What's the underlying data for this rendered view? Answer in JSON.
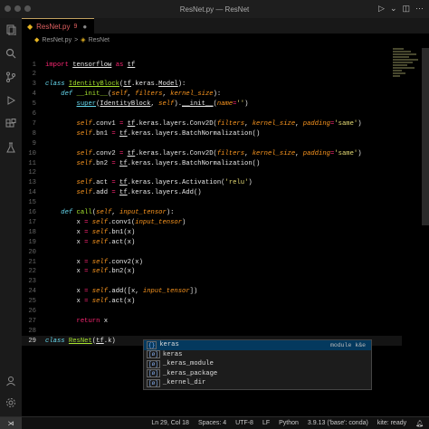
{
  "window": {
    "title": "ResNet.py — ResNet"
  },
  "tab": {
    "filename": "ResNet.py",
    "badge": "9"
  },
  "breadcrumb": {
    "file": "ResNet.py",
    "separator": ">",
    "symbol": "ResNet"
  },
  "code_lines": [
    {
      "num": "1",
      "html": "<span class='kw'>import</span> <span class='ul'>tensorflow</span> <span class='kw'>as</span> <span class='ul'>tf</span>"
    },
    {
      "num": "2",
      "html": ""
    },
    {
      "num": "3",
      "html": "<span class='kwit'>class</span> <span class='cls'>IdentityBlock</span>(<span class='ul'>tf</span>.keras.<span class='ul'>Model</span>):"
    },
    {
      "num": "4",
      "html": "    <span class='kwit'>def</span> <span class='fn'>__init__</span>(<span class='selfc'>self</span>, <span class='it'>filters</span>, <span class='it'>kernel_size</span>):"
    },
    {
      "num": "5",
      "html": "        <span class='bi ul'>super</span>(<span class='ul'>IdentityBlock</span>, <span class='selfc'>self</span>).<span class='ul'>__init__</span>(<span class='it'>name</span><span class='kw'>=</span><span class='str'>''</span>)"
    },
    {
      "num": "6",
      "html": ""
    },
    {
      "num": "7",
      "html": "        <span class='selfc'>self</span>.conv1 <span class='kw'>=</span> <span class='ul'>tf</span>.keras.layers.Conv2D(<span class='it'>filters</span>, <span class='it'>kernel_size</span>, <span class='it'>padding</span><span class='kw'>=</span><span class='str'>'same'</span>)"
    },
    {
      "num": "8",
      "html": "        <span class='selfc'>self</span>.bn1 <span class='kw'>=</span> <span class='ul'>tf</span>.keras.layers.BatchNormalization()"
    },
    {
      "num": "9",
      "html": ""
    },
    {
      "num": "10",
      "html": "        <span class='selfc'>self</span>.conv2 <span class='kw'>=</span> <span class='ul'>tf</span>.keras.layers.Conv2D(<span class='it'>filters</span>, <span class='it'>kernel_size</span>, <span class='it'>padding</span><span class='kw'>=</span><span class='str'>'same'</span>)"
    },
    {
      "num": "11",
      "html": "        <span class='selfc'>self</span>.bn2 <span class='kw'>=</span> <span class='ul'>tf</span>.keras.layers.BatchNormalization()"
    },
    {
      "num": "12",
      "html": ""
    },
    {
      "num": "13",
      "html": "        <span class='selfc'>self</span>.act <span class='kw'>=</span> <span class='ul'>tf</span>.keras.layers.Activation(<span class='str'>'relu'</span>)"
    },
    {
      "num": "14",
      "html": "        <span class='selfc'>self</span>.add <span class='kw'>=</span> <span class='ul'>tf</span>.keras.layers.Add()"
    },
    {
      "num": "15",
      "html": ""
    },
    {
      "num": "16",
      "html": "    <span class='kwit'>def</span> <span class='fn'>call</span>(<span class='selfc'>self</span>, <span class='it'>input_tensor</span>):"
    },
    {
      "num": "17",
      "html": "        x <span class='kw'>=</span> <span class='selfc'>self</span>.conv1(<span class='it'>input_tensor</span>)"
    },
    {
      "num": "18",
      "html": "        x <span class='kw'>=</span> <span class='selfc'>self</span>.bn1(x)"
    },
    {
      "num": "19",
      "html": "        x <span class='kw'>=</span> <span class='selfc'>self</span>.act(x)"
    },
    {
      "num": "20",
      "html": ""
    },
    {
      "num": "21",
      "html": "        x <span class='kw'>=</span> <span class='selfc'>self</span>.conv2(x)"
    },
    {
      "num": "22",
      "html": "        x <span class='kw'>=</span> <span class='selfc'>self</span>.bn2(x)"
    },
    {
      "num": "23",
      "html": ""
    },
    {
      "num": "24",
      "html": "        x <span class='kw'>=</span> <span class='selfc'>self</span>.add([x, <span class='it'>input_tensor</span>])"
    },
    {
      "num": "25",
      "html": "        x <span class='kw'>=</span> <span class='selfc'>self</span>.act(x)"
    },
    {
      "num": "26",
      "html": ""
    },
    {
      "num": "27",
      "html": "        <span class='kw'>return</span> x"
    },
    {
      "num": "28",
      "html": ""
    },
    {
      "num": "29",
      "html": "<span class='kwit'>class</span> <span class='cls'>ResNet</span>(<span class='ul'>tf</span>.k)"
    }
  ],
  "current_line": "29",
  "suggestions": [
    {
      "kind": "{}",
      "label": "keras",
      "detail": "module k&e",
      "selected": true
    },
    {
      "kind": "[ø]",
      "label": "keras",
      "detail": "",
      "selected": false
    },
    {
      "kind": "[ø]",
      "label": "_keras_module",
      "detail": "",
      "selected": false
    },
    {
      "kind": "[ø]",
      "label": "_keras_package",
      "detail": "",
      "selected": false
    },
    {
      "kind": "[ø]",
      "label": "_kernel_dir",
      "detail": "",
      "selected": false
    }
  ],
  "status": {
    "position": "Ln 29, Col 18",
    "spaces": "Spaces: 4",
    "encoding": "UTF-8",
    "eol": "LF",
    "language": "Python",
    "interpreter": "3.9.13 ('base': conda)",
    "kite": "kite: ready"
  },
  "colors": {
    "accent": "#c0a060",
    "keyword": "#f92672",
    "string": "#e6db74",
    "function": "#a6e22e",
    "param": "#fd971f"
  }
}
